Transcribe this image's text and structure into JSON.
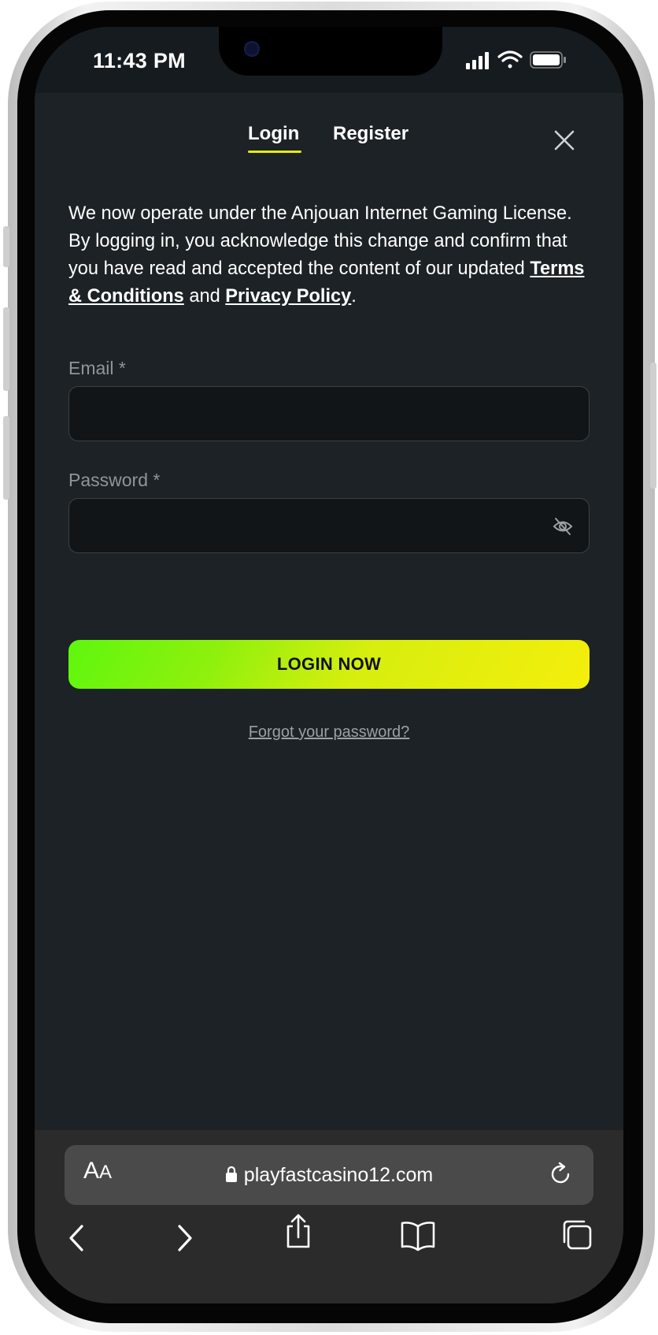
{
  "status_bar": {
    "time": "11:43 PM"
  },
  "tabs": [
    {
      "label": "Login",
      "active": true
    },
    {
      "label": "Register",
      "active": false
    }
  ],
  "close_icon": "close-icon",
  "notice": {
    "text_before": "We now operate under the Anjouan Internet Gaming License. By logging in, you acknowledge this change and confirm that you have read and accepted the content of our updated ",
    "terms_link": "Terms & Conditions",
    "text_and": " and ",
    "privacy_link": "Privacy Policy",
    "text_end": "."
  },
  "form": {
    "email_label": "Email *",
    "email_value": "",
    "password_label": "Password *",
    "password_value": "",
    "password_toggle_icon": "eye-slash-icon",
    "submit_label": "LOGIN NOW",
    "forgot_label": "Forgot your password?"
  },
  "browser": {
    "text_size_label": "A",
    "text_size_label_small": "A",
    "url": "playfastcasino12.com",
    "icons": [
      "lock-icon",
      "reload-icon",
      "back-icon",
      "forward-icon",
      "share-icon",
      "bookmarks-icon",
      "tabs-icon"
    ]
  },
  "colors": {
    "background": "#1c2226",
    "accent": "#e5ec13",
    "button_gradient_start": "#5ef70e",
    "button_gradient_end": "#f5ee0c",
    "input_background": "#111518"
  }
}
